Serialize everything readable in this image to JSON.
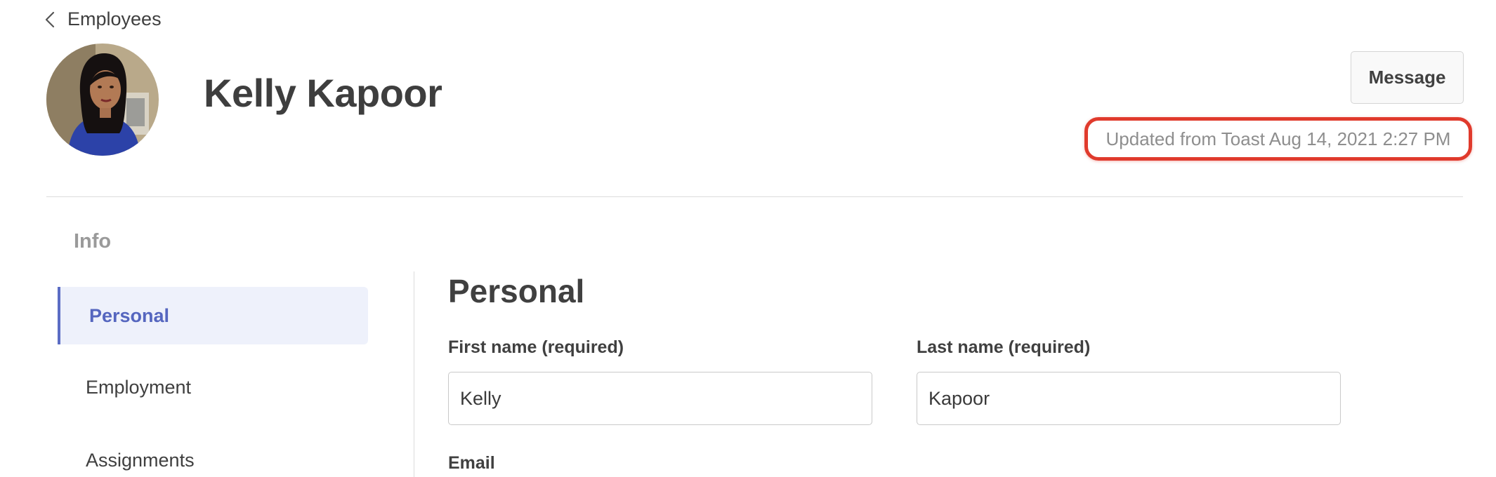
{
  "nav": {
    "back_label": "Employees"
  },
  "employee": {
    "name": "Kelly Kapoor",
    "avatar_icon": "person-photo"
  },
  "actions": {
    "message_label": "Message"
  },
  "sync_status": {
    "text": "Updated from Toast Aug 14, 2021 2:27 PM",
    "highlight_color": "#e03a2c"
  },
  "sidebar": {
    "heading": "Info",
    "items": [
      {
        "label": "Personal",
        "active": true
      },
      {
        "label": "Employment",
        "active": false
      },
      {
        "label": "Assignments",
        "active": false
      }
    ]
  },
  "form": {
    "section_title": "Personal",
    "first_name": {
      "label": "First name (required)",
      "value": "Kelly"
    },
    "last_name": {
      "label": "Last name (required)",
      "value": "Kapoor"
    },
    "email": {
      "label": "Email"
    }
  },
  "colors": {
    "accent": "#5566bf",
    "active_bg": "#eef1fb",
    "text": "#3f3f3f",
    "muted": "#9a9a9a"
  }
}
